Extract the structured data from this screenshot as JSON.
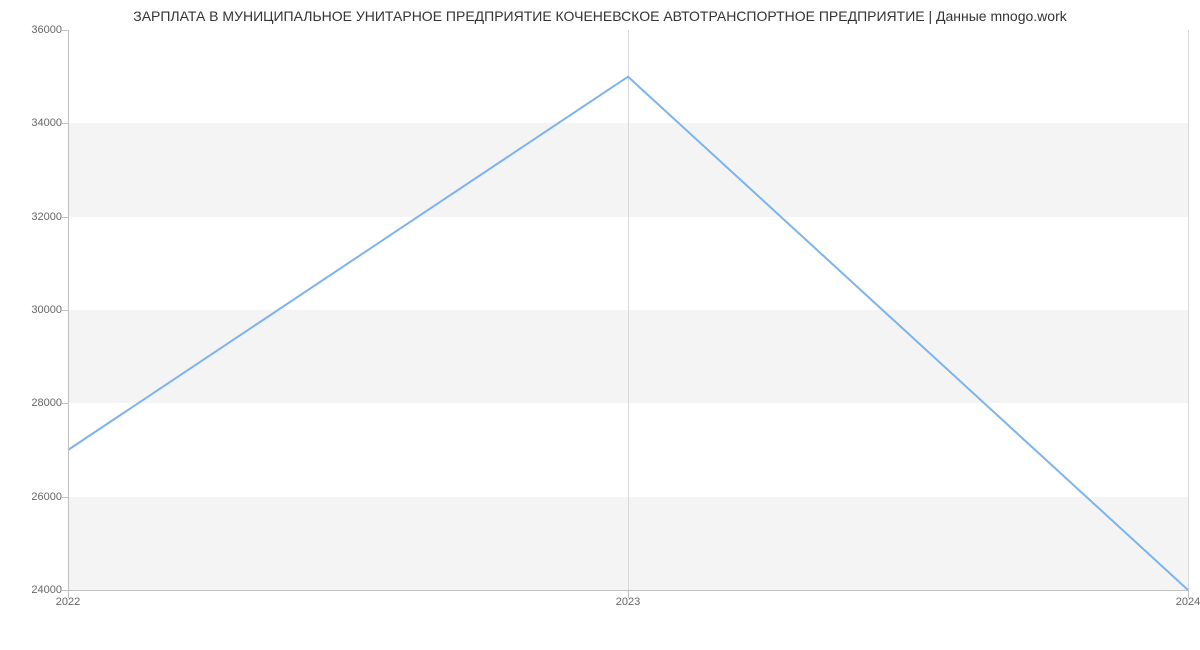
{
  "chart_data": {
    "type": "line",
    "title": "ЗАРПЛАТА В МУНИЦИПАЛЬНОЕ УНИТАРНОЕ ПРЕДПРИЯТИЕ КОЧЕНЕВСКОЕ АВТОТРАНСПОРТНОЕ ПРЕДПРИЯТИЕ | Данные mnogo.work",
    "x": [
      2022,
      2023,
      2024
    ],
    "values": [
      27000,
      35000,
      24000
    ],
    "x_ticks": [
      2022,
      2023,
      2024
    ],
    "y_ticks": [
      24000,
      26000,
      28000,
      30000,
      32000,
      34000,
      36000
    ],
    "xlim": [
      2022,
      2024
    ],
    "ylim": [
      24000,
      36000
    ],
    "line_color": "#7cb5ec"
  }
}
